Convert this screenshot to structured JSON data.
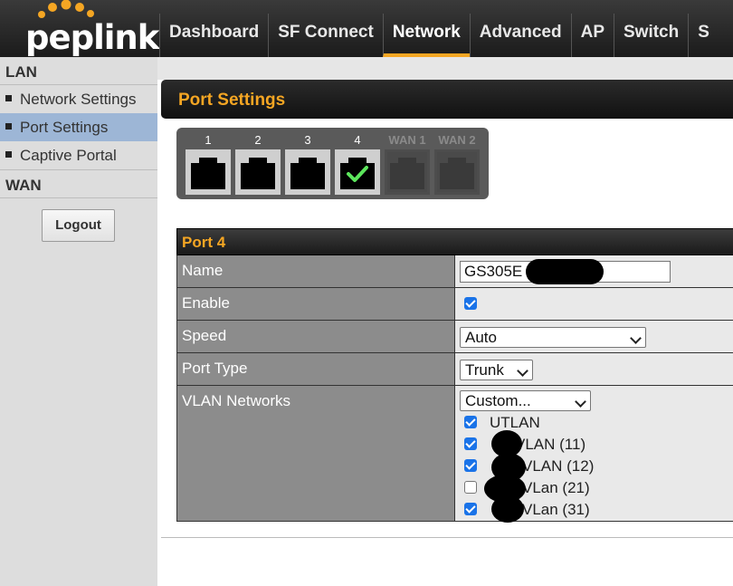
{
  "brand": {
    "logo_text": "peplink",
    "accent": "#f5a623",
    "dot_color": "#f5a623"
  },
  "nav": {
    "tabs": [
      {
        "label": "Dashboard",
        "active": false
      },
      {
        "label": "SF Connect",
        "active": false
      },
      {
        "label": "Network",
        "active": true
      },
      {
        "label": "Advanced",
        "active": false
      },
      {
        "label": "AP",
        "active": false
      },
      {
        "label": "Switch",
        "active": false
      },
      {
        "label": "S",
        "active": false
      }
    ]
  },
  "sidebar": {
    "lan_heading": "LAN",
    "items": [
      {
        "label": "Network Settings",
        "active": false
      },
      {
        "label": "Port Settings",
        "active": true
      },
      {
        "label": "Captive Portal",
        "active": false
      }
    ],
    "wan_heading": "WAN",
    "logout_label": "Logout"
  },
  "section": {
    "title": "Port Settings"
  },
  "ports": [
    {
      "label": "1",
      "enabled": true,
      "selected": false
    },
    {
      "label": "2",
      "enabled": true,
      "selected": false
    },
    {
      "label": "3",
      "enabled": true,
      "selected": false
    },
    {
      "label": "4",
      "enabled": true,
      "selected": true
    },
    {
      "label": "WAN 1",
      "enabled": false,
      "selected": false
    },
    {
      "label": "WAN 2",
      "enabled": false,
      "selected": false
    }
  ],
  "port_detail": {
    "title": "Port 4",
    "name_label": "Name",
    "name_value": "GS305E",
    "enable_label": "Enable",
    "enable_checked": true,
    "speed_label": "Speed",
    "speed_value": "Auto",
    "port_type_label": "Port Type",
    "port_type_value": "Trunk",
    "vlan_label": "VLAN Networks",
    "vlan_mode_value": "Custom...",
    "vlans": [
      {
        "text": "UTLAN",
        "checked": true
      },
      {
        "text": "VLAN (11)",
        "checked": true
      },
      {
        "text": "VLAN (12)",
        "checked": true
      },
      {
        "text": "VLan (21)",
        "checked": false
      },
      {
        "text": "VLan (31)",
        "checked": true
      }
    ]
  }
}
